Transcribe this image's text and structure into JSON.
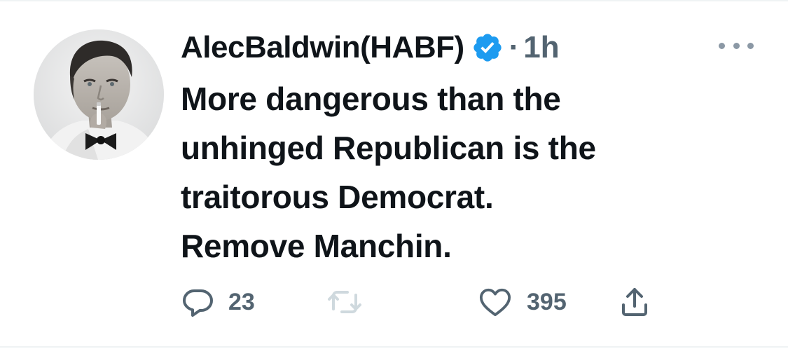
{
  "tweet": {
    "display_name": "AlecBaldwin(HABF)",
    "verified": true,
    "separator": "·",
    "time": "1h",
    "text_lines": [
      "More dangerous than the",
      "unhinged Republican is the",
      "traitorous Democrat.",
      "Remove Manchin."
    ]
  },
  "actions": {
    "reply_count": "23",
    "like_count": "395"
  },
  "icons": {
    "more": "more-horizontal-icon",
    "verified": "verified-badge-icon",
    "reply": "reply-icon",
    "retweet": "retweet-icon",
    "like": "heart-icon",
    "share": "share-icon"
  },
  "colors": {
    "text_primary": "#0f1419",
    "text_secondary": "#536471",
    "verified_blue": "#1d9bf0",
    "retweet_disabled": "#cfd9de"
  }
}
